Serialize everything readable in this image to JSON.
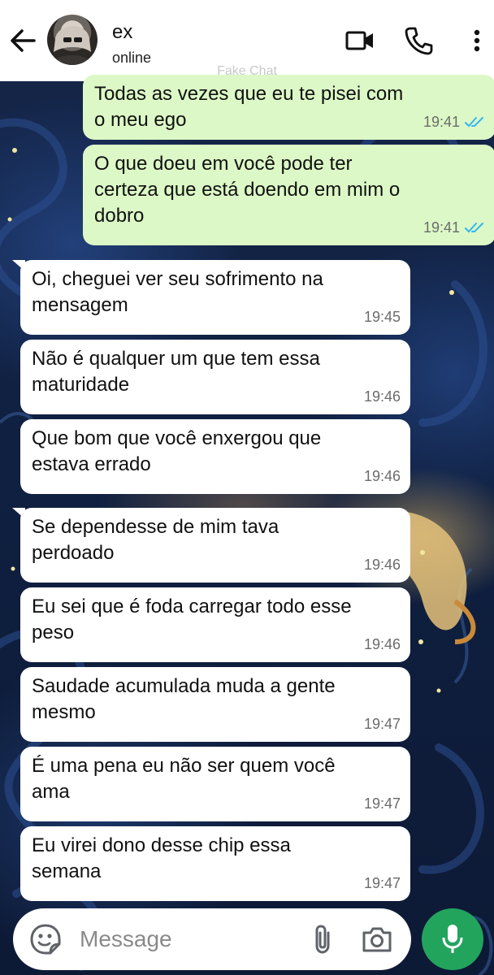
{
  "header": {
    "contact_name": "ex",
    "status": "online",
    "watermark": "Fake Chat",
    "icons": [
      "back-arrow-icon",
      "video-call-icon",
      "phone-icon",
      "more-options-icon"
    ]
  },
  "messages": [
    {
      "direction": "outgoing",
      "text": "Todas as vezes que eu te pisei com\no meu ego",
      "time": "19:41",
      "status": "read"
    },
    {
      "direction": "outgoing",
      "text": "O que doeu em você pode ter\ncerteza que está doendo em mim o\ndobro",
      "time": "19:41",
      "status": "read"
    },
    {
      "direction": "incoming",
      "text": "Oi, cheguei ver seu sofrimento na\nmensagem",
      "time": "19:45"
    },
    {
      "direction": "incoming",
      "text": "Não é qualquer um que tem essa\nmaturidade",
      "time": "19:46"
    },
    {
      "direction": "incoming",
      "text": "Que bom que você enxergou que\nestava errado",
      "time": "19:46"
    },
    {
      "direction": "incoming",
      "text": "Se dependesse de mim tava\nperdoado",
      "time": "19:46"
    },
    {
      "direction": "incoming",
      "text": "Eu sei que é foda carregar todo esse\npeso",
      "time": "19:46"
    },
    {
      "direction": "incoming",
      "text": "Saudade acumulada muda a gente\nmesmo",
      "time": "19:47"
    },
    {
      "direction": "incoming",
      "text": "É uma pena eu não ser quem você\nama",
      "time": "19:47"
    },
    {
      "direction": "incoming",
      "text": "Eu virei dono desse chip essa\nsemana",
      "time": "19:47"
    }
  ],
  "composer": {
    "placeholder": "Message",
    "value": "",
    "icons": [
      "emoji-sticker-icon",
      "attach-icon",
      "camera-icon",
      "mic-icon"
    ]
  },
  "colors": {
    "outgoing_bubble": "#dcf8c6",
    "incoming_bubble": "#ffffff",
    "read_ticks": "#34b7f1",
    "mic_button": "#22a45d"
  }
}
